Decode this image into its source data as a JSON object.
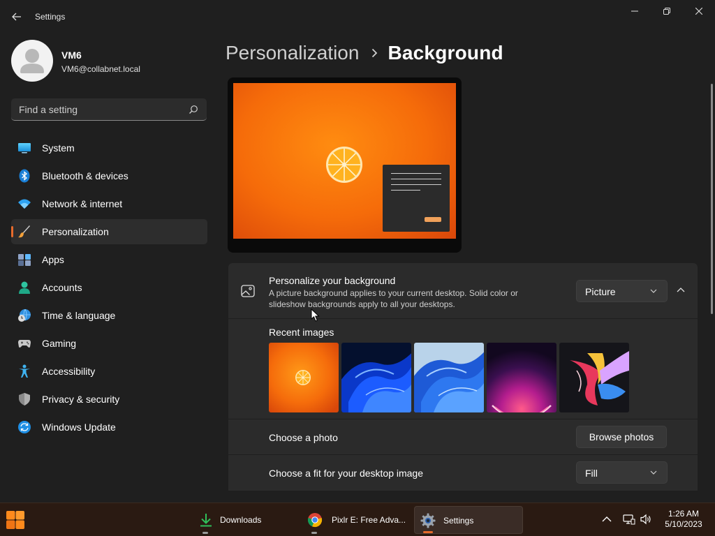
{
  "window": {
    "title": "Settings"
  },
  "profile": {
    "name": "VM6",
    "email": "VM6@collabnet.local"
  },
  "search": {
    "placeholder": "Find a setting"
  },
  "sidebar": {
    "items": [
      {
        "label": "System",
        "icon": "system-icon",
        "active": false
      },
      {
        "label": "Bluetooth & devices",
        "icon": "bluetooth-icon",
        "active": false
      },
      {
        "label": "Network & internet",
        "icon": "wifi-icon",
        "active": false
      },
      {
        "label": "Personalization",
        "icon": "paintbrush-icon",
        "active": true
      },
      {
        "label": "Apps",
        "icon": "apps-icon",
        "active": false
      },
      {
        "label": "Accounts",
        "icon": "person-icon",
        "active": false
      },
      {
        "label": "Time & language",
        "icon": "globe-clock-icon",
        "active": false
      },
      {
        "label": "Gaming",
        "icon": "gamepad-icon",
        "active": false
      },
      {
        "label": "Accessibility",
        "icon": "accessibility-icon",
        "active": false
      },
      {
        "label": "Privacy & security",
        "icon": "shield-icon",
        "active": false
      },
      {
        "label": "Windows Update",
        "icon": "update-icon",
        "active": false
      }
    ]
  },
  "breadcrumb": {
    "parent": "Personalization",
    "current": "Background"
  },
  "background": {
    "title": "Personalize your background",
    "description": "A picture background applies to your current desktop. Solid color or slideshow backgrounds apply to all your desktops.",
    "type_value": "Picture",
    "recent_label": "Recent images",
    "recent_images": [
      "orange-slice",
      "blue-bloom-dark",
      "blue-bloom-light",
      "purple-glow",
      "colorful-ribbon"
    ],
    "choose_photo_label": "Choose a photo",
    "browse_label": "Browse photos",
    "fit_label": "Choose a fit for your desktop image",
    "fit_value": "Fill"
  },
  "taskbar": {
    "apps": [
      {
        "label": "Downloads",
        "icon": "download-icon"
      },
      {
        "label": "Pixlr E: Free Adva...",
        "icon": "chrome-icon"
      },
      {
        "label": "Settings",
        "icon": "settings-gear-icon"
      }
    ],
    "time": "1:26 AM",
    "date": "5/10/2023"
  },
  "colors": {
    "accent": "#e66b2c",
    "window_bg": "#1f1f1f",
    "card_bg": "#2b2b2b",
    "taskbar_bg": "#2a1a12"
  }
}
